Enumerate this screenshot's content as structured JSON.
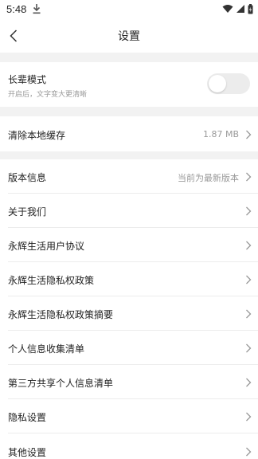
{
  "status_bar": {
    "time": "5:48",
    "icons": [
      "download-icon",
      "wifi-icon",
      "signal-icon",
      "battery-icon"
    ]
  },
  "header": {
    "title": "设置"
  },
  "elder_mode": {
    "label": "长辈模式",
    "description": "开启后，文字变大更清晰",
    "enabled": false
  },
  "cache": {
    "label": "清除本地缓存",
    "value": "1.87 MB"
  },
  "menu_items": [
    {
      "label": "版本信息",
      "value": "当前为最新版本"
    },
    {
      "label": "关于我们",
      "value": ""
    },
    {
      "label": "永辉生活用户协议",
      "value": ""
    },
    {
      "label": "永辉生活隐私权政策",
      "value": ""
    },
    {
      "label": "永辉生活隐私权政策摘要",
      "value": ""
    },
    {
      "label": "个人信息收集清单",
      "value": ""
    },
    {
      "label": "第三方共享个人信息清单",
      "value": ""
    },
    {
      "label": "隐私设置",
      "value": ""
    },
    {
      "label": "其他设置",
      "value": ""
    }
  ],
  "colors": {
    "background_gap": "#f2f2f2",
    "secondary_text": "#9a9a9a",
    "toggle_off": "#ececec"
  }
}
